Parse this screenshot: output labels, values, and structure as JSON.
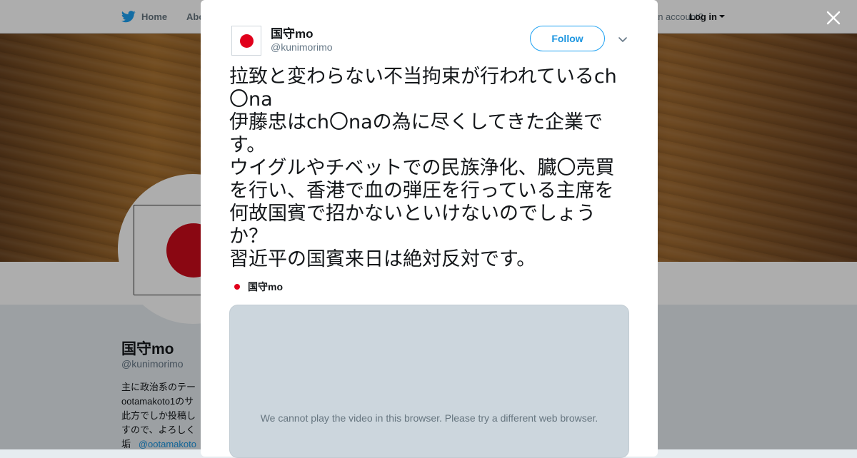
{
  "nav": {
    "home_label": "Home",
    "about_label": "About",
    "account_text": "Have an account?",
    "login_label": "Log in",
    "icons": {
      "home": "twitter-bird-icon",
      "login_caret": "caret-down-icon"
    }
  },
  "profile": {
    "name": "国守mo",
    "handle": "@kunimorimo",
    "bio_lines": [
      "主に政治系のテー",
      "ootamakoto1のサ",
      "此方でしか投稿し",
      "すので、よろしく",
      "垢"
    ],
    "bio_link": "@ootamakoto"
  },
  "modal": {
    "author_name": "国守mo",
    "author_handle": "@kunimorimo",
    "follow_label": "Follow",
    "tweet_text": "拉致と変わらない不当拘束が行われているch〇na\n伊藤忠はch〇naの為に尽くしてきた企業です。\nウイグルやチベットでの民族浄化、臓〇売買を行い、香港で血の弾圧を行っている主席を何故国賓で招かないといけないのでしょうか？\n習近平の国賓来日は絶対反対です。",
    "quote_author": "国守mo",
    "video_message": "We cannot play the video in this browser. Please try a different web browser.",
    "icons": {
      "more": "chevron-down-icon",
      "close": "close-icon"
    }
  },
  "colors": {
    "accent": "#1da1f2",
    "flag_red": "#e1001b",
    "video_bg": "#ccd6dd"
  }
}
